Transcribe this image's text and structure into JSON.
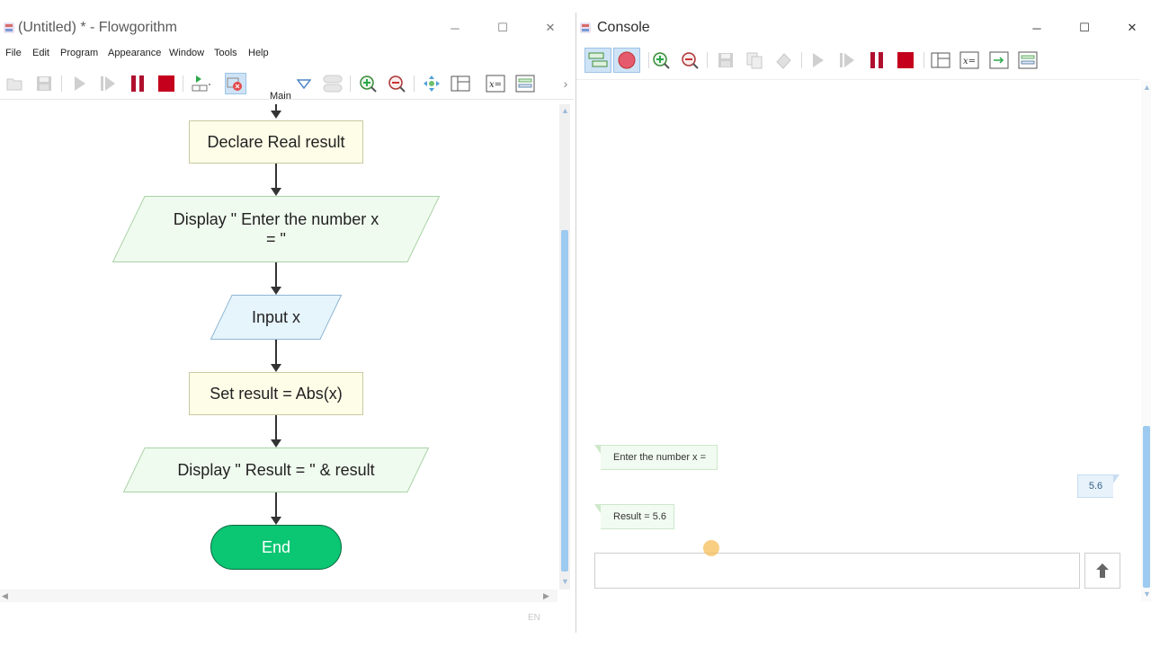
{
  "flowgorithm": {
    "title": "(Untitled) * - Flowgorithm",
    "menu": [
      "File",
      "Edit",
      "Program",
      "Appearance",
      "Window",
      "Tools",
      "Help"
    ],
    "function_selector": "Main",
    "icons": {
      "open": "folder-open-icon",
      "save": "save-icon",
      "run": "play-icon",
      "step": "step-icon",
      "pause": "pause-icon",
      "stop": "stop-icon",
      "layout": "layout-icon",
      "breakpoint": "breakpoint-icon",
      "zoom_in": "zoom-in-icon",
      "zoom_out": "zoom-out-icon"
    },
    "flowchart": {
      "declare": "Declare Real result",
      "display1_line1": "Display \" Enter the number x",
      "display1_line2": "= \"",
      "input": "Input x",
      "assign": "Set result = Abs(x)",
      "display2": "Display \" Result = \" & result",
      "end": "End"
    },
    "status_lang": "EN"
  },
  "console": {
    "title": "Console",
    "messages": [
      {
        "type": "output",
        "text": "Enter the number x ="
      },
      {
        "type": "input",
        "text": "5.6"
      },
      {
        "type": "output",
        "text": "Result = 5.6"
      }
    ],
    "input_value": ""
  },
  "colors": {
    "end_green": "#0bc673",
    "pause_red": "#b0102e",
    "stop_red": "#c4001d",
    "play_gray": "#c9c9c9"
  }
}
